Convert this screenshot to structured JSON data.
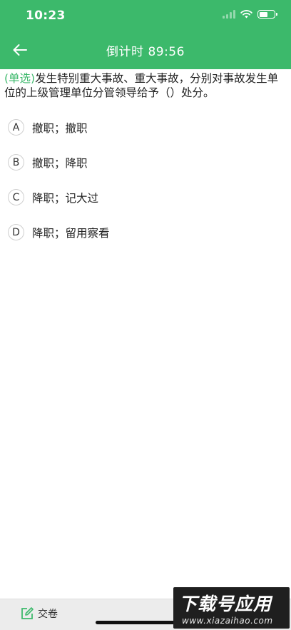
{
  "status_bar": {
    "time": "10:23"
  },
  "header": {
    "title": "倒计时 89:56"
  },
  "question": {
    "type_label": "(单选)",
    "text": "发生特别重大事故、重大事故，分别对事故发生单位的上级管理单位分管领导给予（）处分。"
  },
  "options": [
    {
      "letter": "A",
      "text": "撤职；撤职"
    },
    {
      "letter": "B",
      "text": "撤职；降职"
    },
    {
      "letter": "C",
      "text": "降职；记大过"
    },
    {
      "letter": "D",
      "text": "降职；留用察看"
    }
  ],
  "bottom": {
    "submit_label": "交卷"
  },
  "watermark": {
    "title": "下载号应用",
    "url": "www.xiazaihao.com"
  },
  "colors": {
    "accent": "#3cb96b",
    "text": "#222222",
    "bottom_bar": "#ececec"
  },
  "icons": {
    "back": "arrow-left-icon",
    "submit": "edit-icon",
    "wifi": "wifi-icon",
    "battery": "battery-icon",
    "signal": "signal-icon"
  }
}
